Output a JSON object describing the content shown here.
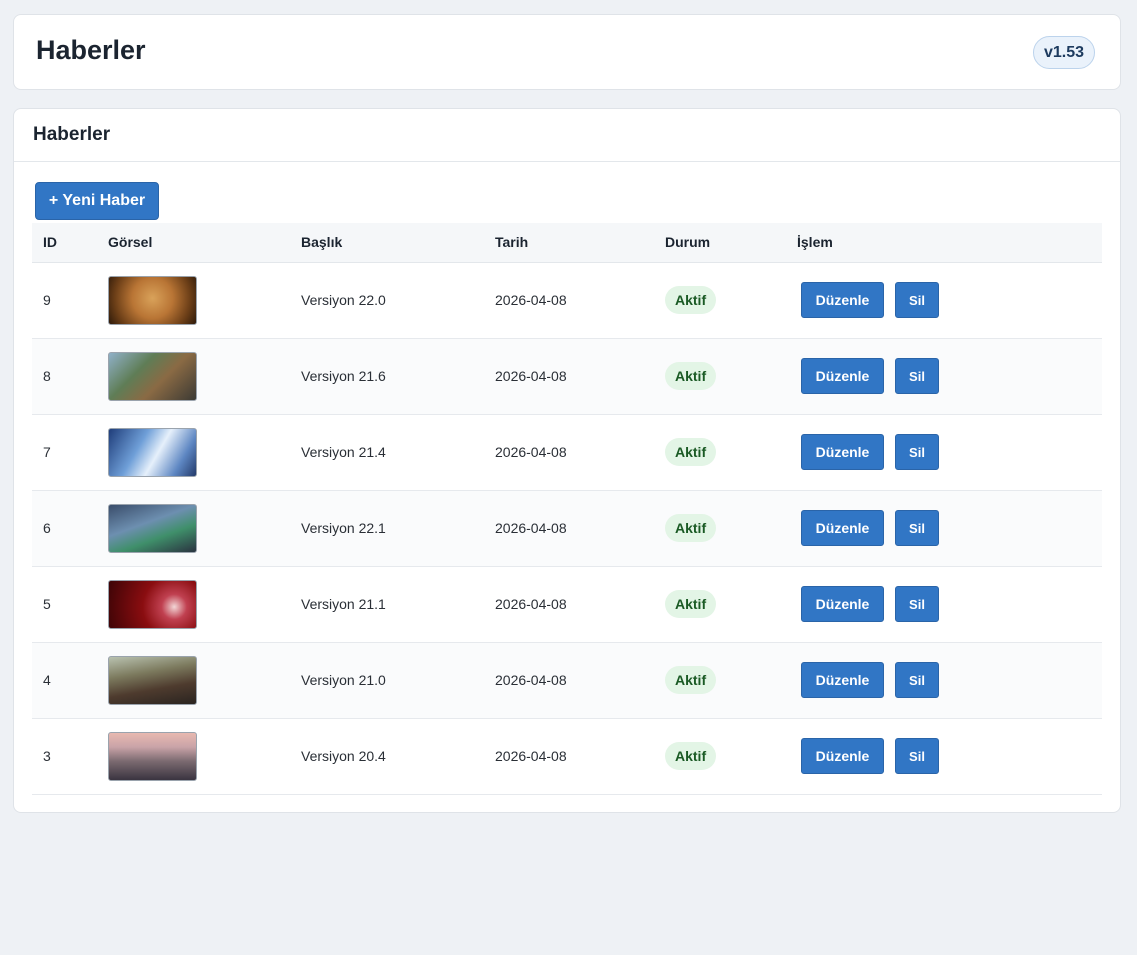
{
  "header": {
    "title": "Haberler",
    "version": "v1.53"
  },
  "card": {
    "title": "Haberler",
    "add_button": "+ Yeni Haber"
  },
  "table": {
    "columns": [
      "ID",
      "Görsel",
      "Başlık",
      "Tarih",
      "Durum",
      "İşlem"
    ],
    "edit_label": "Düzenle",
    "delete_label": "Sil",
    "rows": [
      {
        "id": "9",
        "title": "Versiyon 22.0",
        "date": "2026-04-08",
        "status": "Aktif"
      },
      {
        "id": "8",
        "title": "Versiyon 21.6",
        "date": "2026-04-08",
        "status": "Aktif"
      },
      {
        "id": "7",
        "title": "Versiyon 21.4",
        "date": "2026-04-08",
        "status": "Aktif"
      },
      {
        "id": "6",
        "title": "Versiyon 22.1",
        "date": "2026-04-08",
        "status": "Aktif"
      },
      {
        "id": "5",
        "title": "Versiyon 21.1",
        "date": "2026-04-08",
        "status": "Aktif"
      },
      {
        "id": "4",
        "title": "Versiyon 21.0",
        "date": "2026-04-08",
        "status": "Aktif"
      },
      {
        "id": "3",
        "title": "Versiyon 20.4",
        "date": "2026-04-08",
        "status": "Aktif"
      }
    ]
  },
  "colors": {
    "accent": "#3176c5",
    "status_bg": "#e3f5e6",
    "status_text": "#1a5a24",
    "page_bg": "#eef1f5"
  }
}
